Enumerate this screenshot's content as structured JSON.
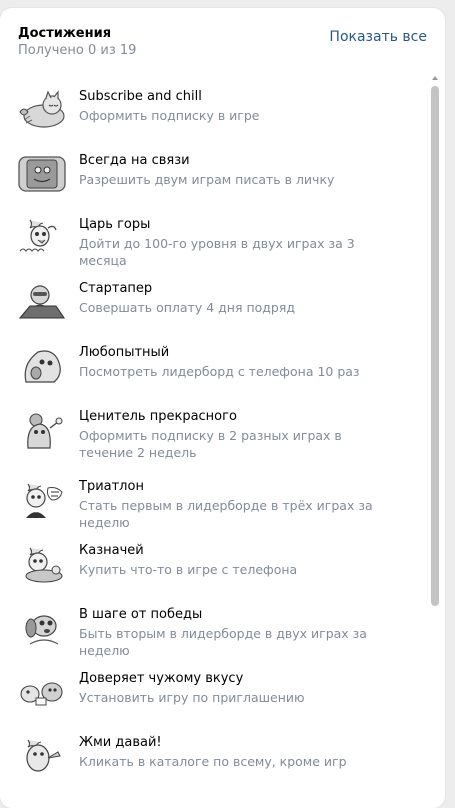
{
  "header": {
    "title": "Достижения",
    "subtitle": "Получено 0 из 19",
    "show_all_label": "Показать все"
  },
  "achievements": [
    {
      "name": "Subscribe and chill",
      "desc": "Оформить подписку в игре",
      "icon": "sleeping-cat-sticker-icon"
    },
    {
      "name": "Всегда на связи",
      "desc": "Разрешить двум играм писать в личку",
      "icon": "phone-sticker-icon"
    },
    {
      "name": "Царь горы",
      "desc": "Дойти до 100-го уровня в двух играх за 3 месяца",
      "icon": "rooster-cheater-sticker-icon"
    },
    {
      "name": "Стартапер",
      "desc": "Совершать оплату 4 дня подряд",
      "icon": "laptop-guy-sticker-icon"
    },
    {
      "name": "Любопытный",
      "desc": "Посмотреть лидерборд с телефона 10 раз",
      "icon": "curious-bird-sticker-icon"
    },
    {
      "name": "Ценитель прекрасного",
      "desc": "Оформить подписку в 2 разных играх в течение 2 недель",
      "icon": "connoisseur-sticker-icon"
    },
    {
      "name": "Триатлон",
      "desc": "Стать первым в лидерборде в трёх играх за неделю",
      "icon": "not-bad-sticker-icon"
    },
    {
      "name": "Казначей",
      "desc": "Купить что-то в игре с телефона",
      "icon": "treasurer-sticker-icon"
    },
    {
      "name": "В шаге от победы",
      "desc": "Быть вторым в лидерборде в двух играх за неделю",
      "icon": "dog-sticker-icon"
    },
    {
      "name": "Доверяет чужому вкусу",
      "desc": "Установить игру по приглашению",
      "icon": "two-birds-sticker-icon"
    },
    {
      "name": "Жми давай!",
      "desc": "Кликать в каталоге по всему, кроме игр",
      "icon": "clicking-bird-sticker-icon"
    }
  ]
}
